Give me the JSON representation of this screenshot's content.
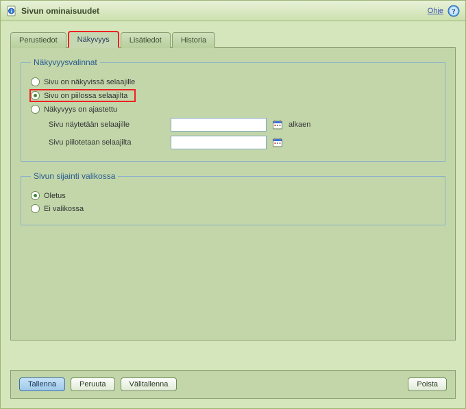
{
  "titlebar": {
    "title": "Sivun ominaisuudet",
    "help_label": "Ohje"
  },
  "tabs": {
    "basic": "Perustiedot",
    "visibility": "Näkyvyys",
    "extra": "Lisätiedot",
    "history": "Historia"
  },
  "visibility_group": {
    "legend": "Näkyvyysvalinnat",
    "radio_visible": "Sivu on näkyvissä selaajille",
    "radio_hidden": "Sivu on piilossa selaajilta",
    "radio_scheduled": "Näkyvyys on ajastettu",
    "show_from_label": "Sivu näytetään selaajille",
    "show_from_value": "",
    "show_from_suffix": "alkaen",
    "hide_from_label": "Sivu piilotetaan selaajilta",
    "hide_from_value": ""
  },
  "menu_group": {
    "legend": "Sivun sijainti valikossa",
    "radio_default": "Oletus",
    "radio_not_in_menu": "Ei valikossa"
  },
  "buttons": {
    "save": "Tallenna",
    "cancel": "Peruuta",
    "stash": "Välitallenna",
    "delete": "Poista"
  },
  "state": {
    "active_tab": "visibility",
    "visibility_selected": "hidden",
    "menu_selected": "default"
  }
}
